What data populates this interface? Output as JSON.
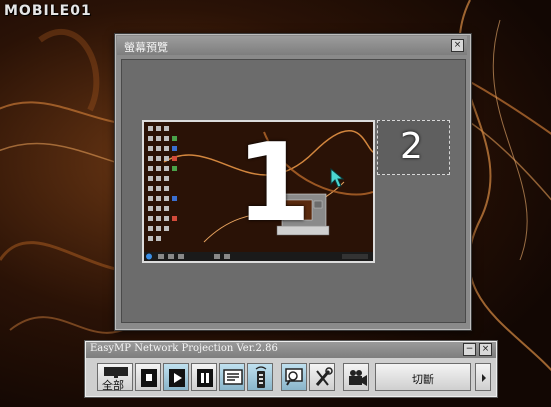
{
  "watermark": {
    "text": "MOBILE01"
  },
  "preview_window": {
    "title": "螢幕預覽",
    "close_glyph": "×",
    "screens": [
      {
        "number": "1",
        "selected": true
      },
      {
        "number": "2",
        "selected": false
      }
    ]
  },
  "toolbar": {
    "title": "EasyMP Network Projection Ver.2.86",
    "minimize_glyph": "−",
    "close_glyph": "×",
    "buttons": [
      {
        "label": "全部",
        "icon": "display-icon"
      },
      {
        "icon": "stop-icon"
      },
      {
        "icon": "play-icon"
      },
      {
        "icon": "pause-icon"
      },
      {
        "icon": "presentation-icon"
      },
      {
        "icon": "remote-icon"
      },
      {
        "icon": "preview-search-icon"
      },
      {
        "icon": "tools-icon"
      },
      {
        "icon": "movie-camera-icon"
      },
      {
        "label": "切斷",
        "icon": "disconnect-icon"
      },
      {
        "icon": "chevron-right-icon"
      }
    ]
  },
  "colors": {
    "wallpaper_dark": "#120703",
    "wallpaper_light": "#d68a45",
    "window_gray": "#8a8a8a",
    "preview_bg": "#6c6c6c",
    "toolbar_bg": "#cfcfcf",
    "cursor": "#4bd6d0"
  }
}
